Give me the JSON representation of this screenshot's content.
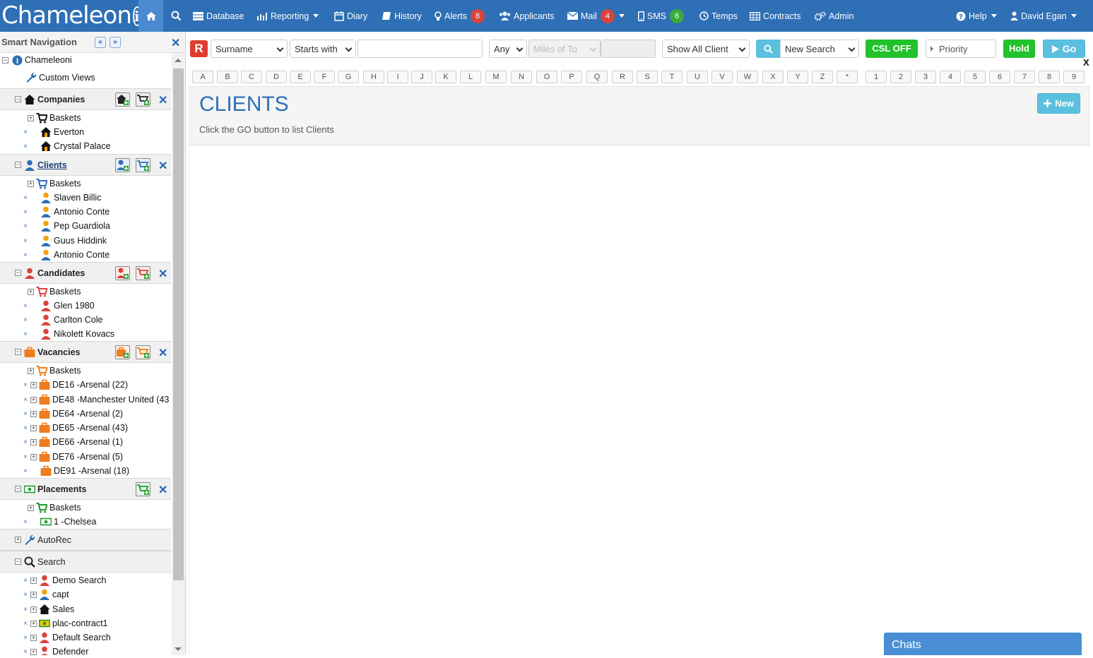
{
  "header": {
    "logo_text": "Chameleon",
    "logo_mark": "i",
    "nav": {
      "database": "Database",
      "reporting": "Reporting",
      "diary": "Diary",
      "history": "History",
      "alerts": "Alerts",
      "alerts_count": "8",
      "applicants": "Applicants",
      "mail": "Mail",
      "mail_count": "4",
      "sms": "SMS",
      "sms_count": "6",
      "temps": "Temps",
      "contracts": "Contracts",
      "admin": "Admin",
      "help": "Help",
      "user": "David Egan"
    }
  },
  "sidebar": {
    "title": "Smart Navigation",
    "root": "Chameleoni",
    "custom_views": "Custom Views",
    "companies": {
      "label": "Companies",
      "items": [
        "Baskets",
        "Everton",
        "Crystal Palace"
      ]
    },
    "clients": {
      "label": "Clients",
      "items": [
        "Baskets",
        "Slaven Billic",
        "Antonio Conte",
        "Pep Guardiola",
        "Guus Hiddink",
        "Antonio Conte"
      ]
    },
    "candidates": {
      "label": "Candidates",
      "items": [
        "Baskets",
        "Glen 1980",
        "Carlton Cole",
        "Nikolett Kovacs"
      ]
    },
    "vacancies": {
      "label": "Vacancies",
      "items": [
        "Baskets",
        "DE16 -Arsenal (22)",
        "DE48 -Manchester United (43",
        "DE64 -Arsenal (2)",
        "DE65 -Arsenal (43)",
        "DE66 -Arsenal (1)",
        "DE76 -Arsenal (5)",
        "DE91 -Arsenal (18)"
      ]
    },
    "placements": {
      "label": "Placements",
      "items": [
        "Baskets",
        "1 -Chelsea"
      ]
    },
    "autorec": "AutoRec",
    "search": {
      "label": "Search",
      "items": [
        "Demo Search",
        "capt",
        "Sales",
        "plac-contract1",
        "Default Search",
        "Defender"
      ]
    }
  },
  "toolbar": {
    "r_label": "R",
    "field_select": "Surname",
    "match_select": "Starts with",
    "search_value": "",
    "any_select": "Any",
    "miles_placeholder": "Miles of To",
    "show_select": "Show All Client",
    "new_search_select": "New Search",
    "csl_label": "CSL OFF",
    "priority_placeholder": "Priority",
    "hold_label": "Hold",
    "go_label": "Go",
    "close_x": "X"
  },
  "alphabet": [
    "A",
    "B",
    "C",
    "D",
    "E",
    "F",
    "G",
    "H",
    "I",
    "J",
    "K",
    "L",
    "M",
    "N",
    "O",
    "P",
    "Q",
    "R",
    "S",
    "T",
    "U",
    "V",
    "W",
    "X",
    "Y",
    "Z",
    "*",
    "1",
    "2",
    "3",
    "4",
    "5",
    "6",
    "7",
    "8",
    "9"
  ],
  "main": {
    "title": "CLIENTS",
    "hint": "Click the GO button to list Clients",
    "new_label": "New"
  },
  "chats_label": "Chats",
  "colors": {
    "brand": "#2f6fb5",
    "csl": "#22c22a",
    "go": "#5bc0de",
    "client_icon": "#2f6fb5",
    "candidate_icon": "#d9433b",
    "vacancy_icon": "#ee7d1f",
    "placement_icon": "#1f9a2e"
  }
}
